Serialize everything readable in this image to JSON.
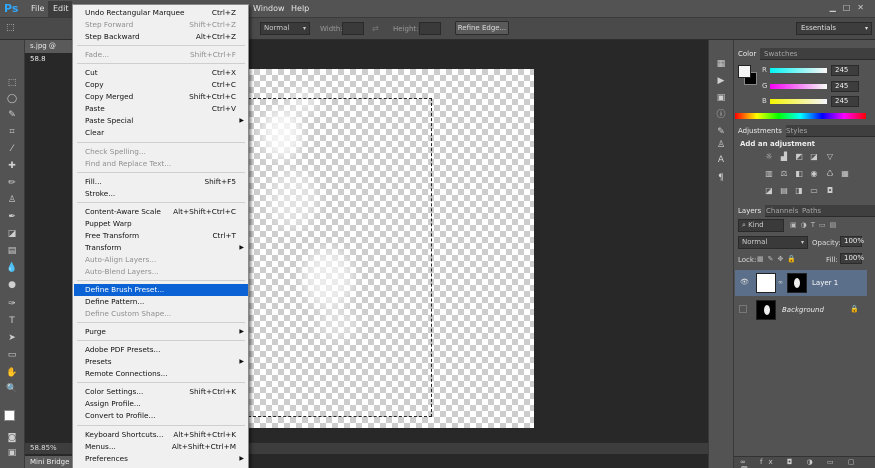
{
  "app": {
    "logo": "Ps",
    "accent": "#31a8ff"
  },
  "menubar": {
    "items": [
      "File",
      "Edit",
      "Window",
      "Help"
    ],
    "active": "Edit"
  },
  "options_bar": {
    "style_value": "Normal",
    "width_label": "Width:",
    "height_label": "Height:",
    "refine_edge": "Refine Edge...",
    "workspace": "Essentials"
  },
  "document": {
    "tab_title": "s.jpg @ 58.8",
    "zoom": "58.85%",
    "mini_bridge": "Mini Bridge"
  },
  "edit_menu": [
    {
      "label": "Undo Rectangular Marquee",
      "shortcut": "Ctrl+Z"
    },
    {
      "label": "Step Forward",
      "shortcut": "Shift+Ctrl+Z",
      "disabled": true
    },
    {
      "label": "Step Backward",
      "shortcut": "Alt+Ctrl+Z"
    },
    {
      "sep": true
    },
    {
      "label": "Fade...",
      "shortcut": "Shift+Ctrl+F",
      "disabled": true
    },
    {
      "sep": true
    },
    {
      "label": "Cut",
      "shortcut": "Ctrl+X"
    },
    {
      "label": "Copy",
      "shortcut": "Ctrl+C"
    },
    {
      "label": "Copy Merged",
      "shortcut": "Shift+Ctrl+C"
    },
    {
      "label": "Paste",
      "shortcut": "Ctrl+V"
    },
    {
      "label": "Paste Special",
      "submenu": true
    },
    {
      "label": "Clear"
    },
    {
      "sep": true
    },
    {
      "label": "Check Spelling...",
      "disabled": true
    },
    {
      "label": "Find and Replace Text...",
      "disabled": true
    },
    {
      "sep": true
    },
    {
      "label": "Fill...",
      "shortcut": "Shift+F5"
    },
    {
      "label": "Stroke..."
    },
    {
      "sep": true
    },
    {
      "label": "Content-Aware Scale",
      "shortcut": "Alt+Shift+Ctrl+C"
    },
    {
      "label": "Puppet Warp"
    },
    {
      "label": "Free Transform",
      "shortcut": "Ctrl+T"
    },
    {
      "label": "Transform",
      "submenu": true
    },
    {
      "label": "Auto-Align Layers...",
      "disabled": true
    },
    {
      "label": "Auto-Blend Layers...",
      "disabled": true
    },
    {
      "sep": true
    },
    {
      "label": "Define Brush Preset...",
      "highlighted": true
    },
    {
      "label": "Define Pattern..."
    },
    {
      "label": "Define Custom Shape...",
      "disabled": true
    },
    {
      "sep": true
    },
    {
      "label": "Purge",
      "submenu": true
    },
    {
      "sep": true
    },
    {
      "label": "Adobe PDF Presets..."
    },
    {
      "label": "Presets",
      "submenu": true
    },
    {
      "label": "Remote Connections..."
    },
    {
      "sep": true
    },
    {
      "label": "Color Settings...",
      "shortcut": "Shift+Ctrl+K"
    },
    {
      "label": "Assign Profile..."
    },
    {
      "label": "Convert to Profile..."
    },
    {
      "sep": true
    },
    {
      "label": "Keyboard Shortcuts...",
      "shortcut": "Alt+Shift+Ctrl+K"
    },
    {
      "label": "Menus...",
      "shortcut": "Alt+Shift+Ctrl+M"
    },
    {
      "label": "Preferences",
      "submenu": true
    }
  ],
  "color_panel": {
    "tabs": [
      "Color",
      "Swatches"
    ],
    "channels": [
      {
        "name": "R",
        "value": "245",
        "color": "#ff0000"
      },
      {
        "name": "G",
        "value": "245",
        "color": "#00ff00"
      },
      {
        "name": "B",
        "value": "245",
        "color": "#0000ff"
      }
    ]
  },
  "adjustments_panel": {
    "tabs": [
      "Adjustments",
      "Styles"
    ],
    "heading": "Add an adjustment"
  },
  "layers_panel": {
    "tabs": [
      "Layers",
      "Channels",
      "Paths"
    ],
    "kind": "Kind",
    "blend_mode": "Normal",
    "opacity_label": "Opacity:",
    "opacity": "100%",
    "lock_label": "Lock:",
    "fill_label": "Fill:",
    "fill": "100%",
    "layers": [
      {
        "name": "Layer 1",
        "selected": true
      },
      {
        "name": "Background",
        "italic": true
      }
    ],
    "selection_color": "#5b6f8a"
  }
}
